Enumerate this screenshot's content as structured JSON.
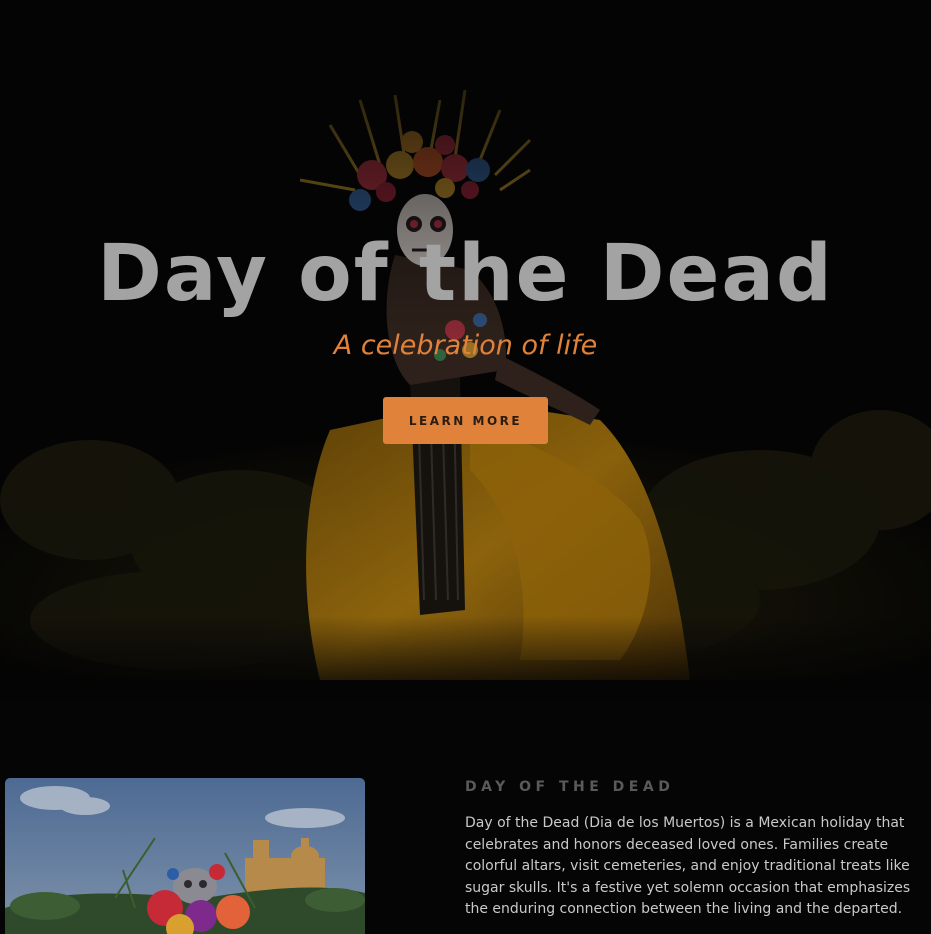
{
  "hero": {
    "title": "Day of the Dead",
    "subtitle": "A celebration of life",
    "cta_label": "LEARN MORE",
    "image": "hero-photo-woman-catrina-costume"
  },
  "about": {
    "heading": "DAY OF THE DEAD",
    "body": "Day of the Dead (Dia de los Muertos) is a Mexican holiday that celebrates and honors deceased loved ones. Families create colorful altars, visit cemeteries, and enjoy traditional treats like sugar skulls. It's a festive yet solemn occasion that emphasizes the enduring connection between the living and the departed.",
    "image": "photo-skull-with-flowers-and-church"
  },
  "colors": {
    "accent": "#e0823a",
    "background": "#050505",
    "title_gray": "#a3a3a3",
    "heading_gray": "#5a5a5a",
    "body_text": "#c9c9c9"
  }
}
